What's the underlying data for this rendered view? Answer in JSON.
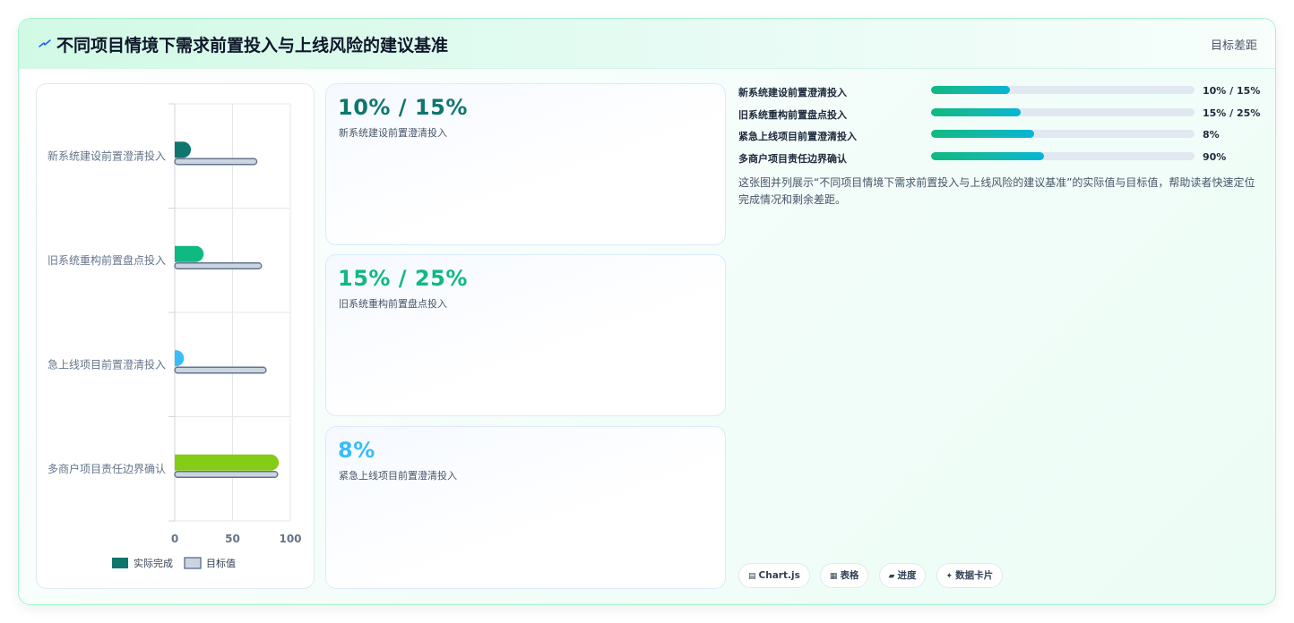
{
  "header": {
    "title": "不同项目情境下需求前置投入与上线风险的建议基准",
    "right_label": "目标差距",
    "icon": "lightning-icon"
  },
  "colors": {
    "series1": [
      "#0f766e",
      "#10b981",
      "#38bdf8",
      "#84cc16"
    ],
    "series2_fill": "#cbd5e1",
    "series2_border": "#64748b",
    "accent": "#10b981"
  },
  "chart_data": {
    "type": "bar",
    "orientation": "horizontal",
    "categories": [
      "新系统建设前置澄清投入",
      "旧系统重构前置盘点投入",
      "紧急上线项目前置澄清投入",
      "多商户项目责任边界确认"
    ],
    "series": [
      {
        "name": "实际完成",
        "values": [
          14,
          25,
          8,
          90
        ]
      },
      {
        "name": "目标值",
        "values": [
          71,
          75,
          79,
          89
        ]
      }
    ],
    "xlim": [
      0,
      100
    ],
    "xticks": [
      0,
      50,
      100
    ],
    "grid": true,
    "legend": "bottom"
  },
  "stat_cards": [
    {
      "value": "10% / 15%",
      "label": "新系统建设前置澄清投入",
      "color": "#0f766e"
    },
    {
      "value": "15% / 25%",
      "label": "旧系统重构前置盘点投入",
      "color": "#10b981"
    },
    {
      "value": "8%",
      "label": "紧急上线项目前置澄清投入",
      "color": "#38bdf8"
    }
  ],
  "progress": [
    {
      "label": "新系统建设前置澄清投入",
      "value_text": "10% / 15%",
      "fill": 0.3
    },
    {
      "label": "旧系统重构前置盘点投入",
      "value_text": "15% / 25%",
      "fill": 0.34
    },
    {
      "label": "紧急上线项目前置澄清投入",
      "value_text": "8%",
      "fill": 0.39
    },
    {
      "label": "多商户项目责任边界确认",
      "value_text": "90%",
      "fill": 0.43
    }
  ],
  "description": "这张图并列展示“不同项目情境下需求前置投入与上线风险的建议基准”的实际值与目标值，帮助读者快速定位完成情况和剩余差距。",
  "tags": [
    {
      "icon": "▤",
      "label": "Chart.js"
    },
    {
      "icon": "▦",
      "label": "表格"
    },
    {
      "icon": "▰",
      "label": "进度"
    },
    {
      "icon": "✦",
      "label": "数据卡片"
    }
  ]
}
